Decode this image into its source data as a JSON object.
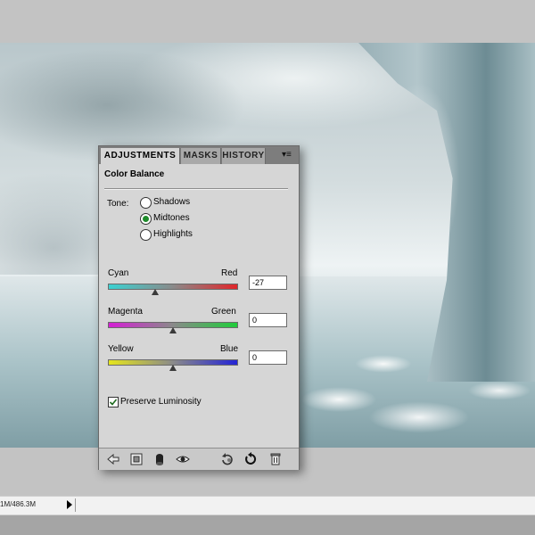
{
  "status_bar": {
    "doc_info": "1M/486.3M"
  },
  "panel": {
    "tabs": [
      {
        "label": "ADJUSTMENTS",
        "active": true
      },
      {
        "label": "MASKS",
        "active": false
      },
      {
        "label": "HISTORY",
        "active": false
      }
    ],
    "menu_icon": "▾≡",
    "title": "Color Balance",
    "tone": {
      "label": "Tone:",
      "options": [
        {
          "label": "Shadows",
          "selected": false
        },
        {
          "label": "Midtones",
          "selected": true
        },
        {
          "label": "Highlights",
          "selected": false
        }
      ]
    },
    "sliders": [
      {
        "left_label": "Cyan",
        "right_label": "Red",
        "value": "-27",
        "min": -100,
        "max": 100
      },
      {
        "left_label": "Magenta",
        "right_label": "Green",
        "value": "0",
        "min": -100,
        "max": 100
      },
      {
        "left_label": "Yellow",
        "right_label": "Blue",
        "value": "0",
        "min": -100,
        "max": 100
      }
    ],
    "preserve_luminosity": {
      "label": "Preserve Luminosity",
      "checked": true
    },
    "footer_icons": [
      "back-arrow-icon",
      "expand-view-icon",
      "clip-to-layer-icon",
      "visibility-eye-icon",
      "view-previous-icon",
      "reset-icon",
      "trash-icon"
    ]
  },
  "colors": {
    "panel_bg": "#d6d6d6",
    "tab_bar": "#7d7d7d",
    "radio_selected": "#1e8b2b"
  }
}
